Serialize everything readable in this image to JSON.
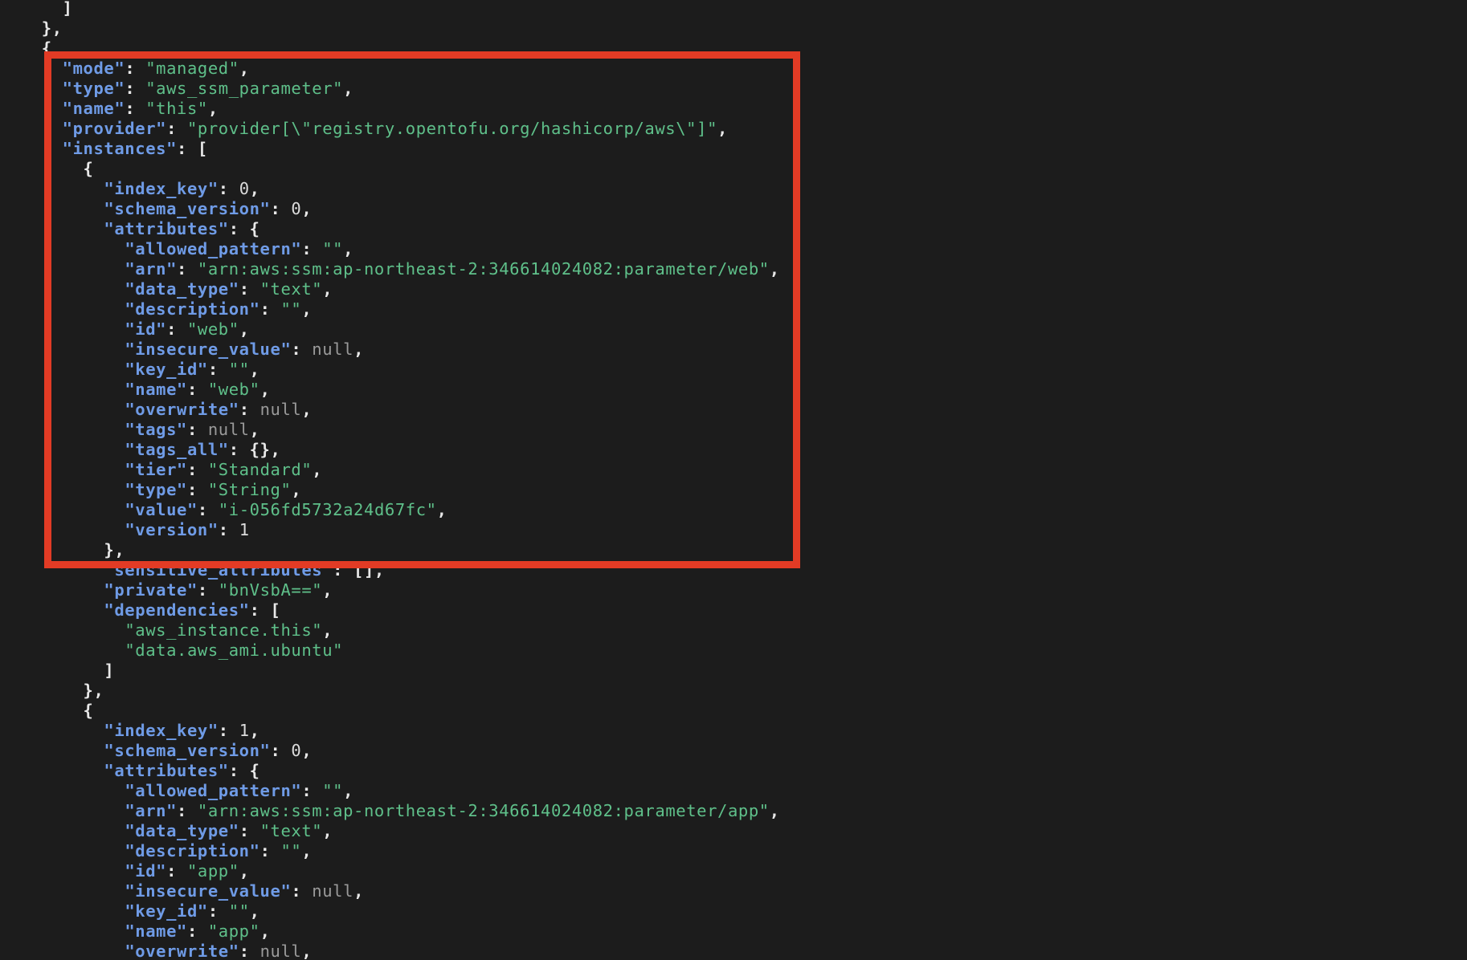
{
  "theme": {
    "background": "#1c1c1c",
    "key_color": "#6f9be6",
    "string_color": "#5fc08a",
    "number_color": "#dcdcdc",
    "null_color": "#9a9a9a",
    "punct_color": "#e8e8e8",
    "highlight_color": "#e23b25"
  },
  "lines": [
    {
      "indent": 4,
      "tokens": [
        {
          "t": "p",
          "v": "}"
        }
      ]
    },
    {
      "indent": 3,
      "tokens": [
        {
          "t": "p",
          "v": "]"
        }
      ]
    },
    {
      "indent": 2,
      "tokens": [
        {
          "t": "p",
          "v": "},"
        }
      ]
    },
    {
      "indent": 2,
      "tokens": [
        {
          "t": "p",
          "v": "{"
        }
      ]
    },
    {
      "indent": 3,
      "tokens": [
        {
          "t": "k",
          "v": "\"mode\""
        },
        {
          "t": "p",
          "v": ": "
        },
        {
          "t": "s",
          "v": "\"managed\""
        },
        {
          "t": "p",
          "v": ","
        }
      ]
    },
    {
      "indent": 3,
      "tokens": [
        {
          "t": "k",
          "v": "\"type\""
        },
        {
          "t": "p",
          "v": ": "
        },
        {
          "t": "s",
          "v": "\"aws_ssm_parameter\""
        },
        {
          "t": "p",
          "v": ","
        }
      ]
    },
    {
      "indent": 3,
      "tokens": [
        {
          "t": "k",
          "v": "\"name\""
        },
        {
          "t": "p",
          "v": ": "
        },
        {
          "t": "s",
          "v": "\"this\""
        },
        {
          "t": "p",
          "v": ","
        }
      ]
    },
    {
      "indent": 3,
      "tokens": [
        {
          "t": "k",
          "v": "\"provider\""
        },
        {
          "t": "p",
          "v": ": "
        },
        {
          "t": "s",
          "v": "\"provider[\\\"registry.opentofu.org/hashicorp/aws\\\"]\""
        },
        {
          "t": "p",
          "v": ","
        }
      ]
    },
    {
      "indent": 3,
      "tokens": [
        {
          "t": "k",
          "v": "\"instances\""
        },
        {
          "t": "p",
          "v": ": ["
        }
      ]
    },
    {
      "indent": 4,
      "tokens": [
        {
          "t": "p",
          "v": "{"
        }
      ]
    },
    {
      "indent": 5,
      "tokens": [
        {
          "t": "k",
          "v": "\"index_key\""
        },
        {
          "t": "p",
          "v": ": "
        },
        {
          "t": "n",
          "v": "0"
        },
        {
          "t": "p",
          "v": ","
        }
      ]
    },
    {
      "indent": 5,
      "tokens": [
        {
          "t": "k",
          "v": "\"schema_version\""
        },
        {
          "t": "p",
          "v": ": "
        },
        {
          "t": "n",
          "v": "0"
        },
        {
          "t": "p",
          "v": ","
        }
      ]
    },
    {
      "indent": 5,
      "tokens": [
        {
          "t": "k",
          "v": "\"attributes\""
        },
        {
          "t": "p",
          "v": ": {"
        }
      ]
    },
    {
      "indent": 6,
      "tokens": [
        {
          "t": "k",
          "v": "\"allowed_pattern\""
        },
        {
          "t": "p",
          "v": ": "
        },
        {
          "t": "s",
          "v": "\"\""
        },
        {
          "t": "p",
          "v": ","
        }
      ]
    },
    {
      "indent": 6,
      "tokens": [
        {
          "t": "k",
          "v": "\"arn\""
        },
        {
          "t": "p",
          "v": ": "
        },
        {
          "t": "s",
          "v": "\"arn:aws:ssm:ap-northeast-2:346614024082:parameter/web\""
        },
        {
          "t": "p",
          "v": ","
        }
      ]
    },
    {
      "indent": 6,
      "tokens": [
        {
          "t": "k",
          "v": "\"data_type\""
        },
        {
          "t": "p",
          "v": ": "
        },
        {
          "t": "s",
          "v": "\"text\""
        },
        {
          "t": "p",
          "v": ","
        }
      ]
    },
    {
      "indent": 6,
      "tokens": [
        {
          "t": "k",
          "v": "\"description\""
        },
        {
          "t": "p",
          "v": ": "
        },
        {
          "t": "s",
          "v": "\"\""
        },
        {
          "t": "p",
          "v": ","
        }
      ]
    },
    {
      "indent": 6,
      "tokens": [
        {
          "t": "k",
          "v": "\"id\""
        },
        {
          "t": "p",
          "v": ": "
        },
        {
          "t": "s",
          "v": "\"web\""
        },
        {
          "t": "p",
          "v": ","
        }
      ]
    },
    {
      "indent": 6,
      "tokens": [
        {
          "t": "k",
          "v": "\"insecure_value\""
        },
        {
          "t": "p",
          "v": ": "
        },
        {
          "t": "nl",
          "v": "null"
        },
        {
          "t": "p",
          "v": ","
        }
      ]
    },
    {
      "indent": 6,
      "tokens": [
        {
          "t": "k",
          "v": "\"key_id\""
        },
        {
          "t": "p",
          "v": ": "
        },
        {
          "t": "s",
          "v": "\"\""
        },
        {
          "t": "p",
          "v": ","
        }
      ]
    },
    {
      "indent": 6,
      "tokens": [
        {
          "t": "k",
          "v": "\"name\""
        },
        {
          "t": "p",
          "v": ": "
        },
        {
          "t": "s",
          "v": "\"web\""
        },
        {
          "t": "p",
          "v": ","
        }
      ]
    },
    {
      "indent": 6,
      "tokens": [
        {
          "t": "k",
          "v": "\"overwrite\""
        },
        {
          "t": "p",
          "v": ": "
        },
        {
          "t": "nl",
          "v": "null"
        },
        {
          "t": "p",
          "v": ","
        }
      ]
    },
    {
      "indent": 6,
      "tokens": [
        {
          "t": "k",
          "v": "\"tags\""
        },
        {
          "t": "p",
          "v": ": "
        },
        {
          "t": "nl",
          "v": "null"
        },
        {
          "t": "p",
          "v": ","
        }
      ]
    },
    {
      "indent": 6,
      "tokens": [
        {
          "t": "k",
          "v": "\"tags_all\""
        },
        {
          "t": "p",
          "v": ": {},"
        }
      ]
    },
    {
      "indent": 6,
      "tokens": [
        {
          "t": "k",
          "v": "\"tier\""
        },
        {
          "t": "p",
          "v": ": "
        },
        {
          "t": "s",
          "v": "\"Standard\""
        },
        {
          "t": "p",
          "v": ","
        }
      ]
    },
    {
      "indent": 6,
      "tokens": [
        {
          "t": "k",
          "v": "\"type\""
        },
        {
          "t": "p",
          "v": ": "
        },
        {
          "t": "s",
          "v": "\"String\""
        },
        {
          "t": "p",
          "v": ","
        }
      ]
    },
    {
      "indent": 6,
      "tokens": [
        {
          "t": "k",
          "v": "\"value\""
        },
        {
          "t": "p",
          "v": ": "
        },
        {
          "t": "s",
          "v": "\"i-056fd5732a24d67fc\""
        },
        {
          "t": "p",
          "v": ","
        }
      ]
    },
    {
      "indent": 6,
      "tokens": [
        {
          "t": "k",
          "v": "\"version\""
        },
        {
          "t": "p",
          "v": ": "
        },
        {
          "t": "n",
          "v": "1"
        }
      ]
    },
    {
      "indent": 5,
      "tokens": [
        {
          "t": "p",
          "v": "},"
        }
      ]
    },
    {
      "indent": 5,
      "tokens": [
        {
          "t": "k",
          "v": "\"sensitive_attributes\""
        },
        {
          "t": "p",
          "v": ": [],"
        }
      ]
    },
    {
      "indent": 5,
      "tokens": [
        {
          "t": "k",
          "v": "\"private\""
        },
        {
          "t": "p",
          "v": ": "
        },
        {
          "t": "s",
          "v": "\"bnVsbA==\""
        },
        {
          "t": "p",
          "v": ","
        }
      ]
    },
    {
      "indent": 5,
      "tokens": [
        {
          "t": "k",
          "v": "\"dependencies\""
        },
        {
          "t": "p",
          "v": ": ["
        }
      ]
    },
    {
      "indent": 6,
      "tokens": [
        {
          "t": "s",
          "v": "\"aws_instance.this\""
        },
        {
          "t": "p",
          "v": ","
        }
      ]
    },
    {
      "indent": 6,
      "tokens": [
        {
          "t": "s",
          "v": "\"data.aws_ami.ubuntu\""
        }
      ]
    },
    {
      "indent": 5,
      "tokens": [
        {
          "t": "p",
          "v": "]"
        }
      ]
    },
    {
      "indent": 4,
      "tokens": [
        {
          "t": "p",
          "v": "},"
        }
      ]
    },
    {
      "indent": 4,
      "tokens": [
        {
          "t": "p",
          "v": "{"
        }
      ]
    },
    {
      "indent": 5,
      "tokens": [
        {
          "t": "k",
          "v": "\"index_key\""
        },
        {
          "t": "p",
          "v": ": "
        },
        {
          "t": "n",
          "v": "1"
        },
        {
          "t": "p",
          "v": ","
        }
      ]
    },
    {
      "indent": 5,
      "tokens": [
        {
          "t": "k",
          "v": "\"schema_version\""
        },
        {
          "t": "p",
          "v": ": "
        },
        {
          "t": "n",
          "v": "0"
        },
        {
          "t": "p",
          "v": ","
        }
      ]
    },
    {
      "indent": 5,
      "tokens": [
        {
          "t": "k",
          "v": "\"attributes\""
        },
        {
          "t": "p",
          "v": ": {"
        }
      ]
    },
    {
      "indent": 6,
      "tokens": [
        {
          "t": "k",
          "v": "\"allowed_pattern\""
        },
        {
          "t": "p",
          "v": ": "
        },
        {
          "t": "s",
          "v": "\"\""
        },
        {
          "t": "p",
          "v": ","
        }
      ]
    },
    {
      "indent": 6,
      "tokens": [
        {
          "t": "k",
          "v": "\"arn\""
        },
        {
          "t": "p",
          "v": ": "
        },
        {
          "t": "s",
          "v": "\"arn:aws:ssm:ap-northeast-2:346614024082:parameter/app\""
        },
        {
          "t": "p",
          "v": ","
        }
      ]
    },
    {
      "indent": 6,
      "tokens": [
        {
          "t": "k",
          "v": "\"data_type\""
        },
        {
          "t": "p",
          "v": ": "
        },
        {
          "t": "s",
          "v": "\"text\""
        },
        {
          "t": "p",
          "v": ","
        }
      ]
    },
    {
      "indent": 6,
      "tokens": [
        {
          "t": "k",
          "v": "\"description\""
        },
        {
          "t": "p",
          "v": ": "
        },
        {
          "t": "s",
          "v": "\"\""
        },
        {
          "t": "p",
          "v": ","
        }
      ]
    },
    {
      "indent": 6,
      "tokens": [
        {
          "t": "k",
          "v": "\"id\""
        },
        {
          "t": "p",
          "v": ": "
        },
        {
          "t": "s",
          "v": "\"app\""
        },
        {
          "t": "p",
          "v": ","
        }
      ]
    },
    {
      "indent": 6,
      "tokens": [
        {
          "t": "k",
          "v": "\"insecure_value\""
        },
        {
          "t": "p",
          "v": ": "
        },
        {
          "t": "nl",
          "v": "null"
        },
        {
          "t": "p",
          "v": ","
        }
      ]
    },
    {
      "indent": 6,
      "tokens": [
        {
          "t": "k",
          "v": "\"key_id\""
        },
        {
          "t": "p",
          "v": ": "
        },
        {
          "t": "s",
          "v": "\"\""
        },
        {
          "t": "p",
          "v": ","
        }
      ]
    },
    {
      "indent": 6,
      "tokens": [
        {
          "t": "k",
          "v": "\"name\""
        },
        {
          "t": "p",
          "v": ": "
        },
        {
          "t": "s",
          "v": "\"app\""
        },
        {
          "t": "p",
          "v": ","
        }
      ]
    },
    {
      "indent": 6,
      "tokens": [
        {
          "t": "k",
          "v": "\"overwrite\""
        },
        {
          "t": "p",
          "v": ": "
        },
        {
          "t": "nl",
          "v": "null"
        },
        {
          "t": "p",
          "v": ","
        }
      ]
    }
  ]
}
